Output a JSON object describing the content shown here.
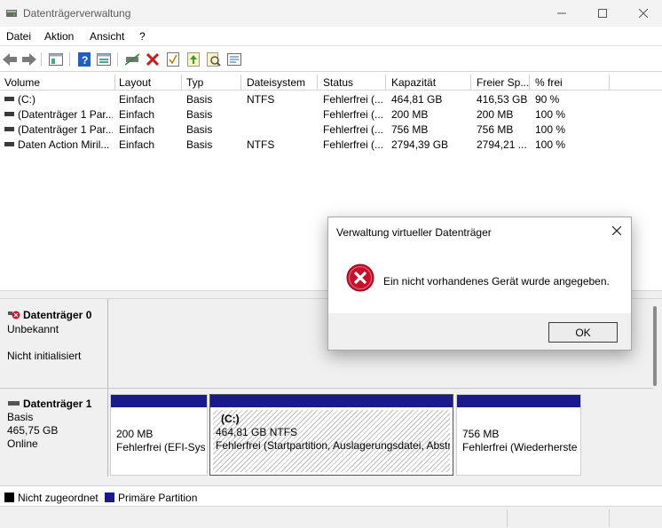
{
  "window": {
    "title": "Datenträgerverwaltung"
  },
  "menu": [
    "Datei",
    "Aktion",
    "Ansicht",
    "?"
  ],
  "toolbar": {
    "icons": [
      "back-icon",
      "forward-icon",
      "properties-icon",
      "help-icon",
      "view-icon",
      "connect-icon",
      "delete-icon",
      "check-icon",
      "import-icon",
      "search-icon",
      "refresh-icon"
    ]
  },
  "table": {
    "headers": [
      "Volume",
      "Layout",
      "Typ",
      "Dateisystem",
      "Status",
      "Kapazität",
      "Freier Sp...",
      "% frei"
    ],
    "rows": [
      [
        "(C:)",
        "Einfach",
        "Basis",
        "NTFS",
        "Fehlerfrei (...",
        "464,81 GB",
        "416,53 GB",
        "90 %"
      ],
      [
        "(Datenträger 1 Par...",
        "Einfach",
        "Basis",
        "",
        "Fehlerfrei (...",
        "200 MB",
        "200 MB",
        "100 %"
      ],
      [
        "(Datenträger 1 Par...",
        "Einfach",
        "Basis",
        "",
        "Fehlerfrei (...",
        "756 MB",
        "756 MB",
        "100 %"
      ],
      [
        "Daten Action Miril...",
        "Einfach",
        "Basis",
        "NTFS",
        "Fehlerfrei (...",
        "2794,39 GB",
        "2794,21 ...",
        "100 %"
      ]
    ]
  },
  "disks": {
    "disk0": {
      "name": "Datenträger 0",
      "type": "Unbekannt",
      "state": "Nicht initialisiert"
    },
    "disk1": {
      "name": "Datenträger 1",
      "type": "Basis",
      "size": "465,75 GB",
      "state": "Online",
      "partitions": [
        {
          "label": "",
          "size": "200 MB",
          "status": "Fehlerfrei (EFI-Syst"
        },
        {
          "label": "(C:)",
          "size": "464,81 GB NTFS",
          "status": "Fehlerfrei (Startpartition, Auslagerungsdatei, Abstr"
        },
        {
          "label": "",
          "size": "756 MB",
          "status": "Fehlerfrei (Wiederherste"
        }
      ]
    }
  },
  "legend": {
    "unallocated": "Nicht zugeordnet",
    "primary": "Primäre Partition",
    "colors": {
      "unallocated": "#000000",
      "primary": "#1a1a8c"
    }
  },
  "dialog": {
    "title": "Verwaltung virtueller Datenträger",
    "message": "Ein nicht vorhandenes Gerät wurde angegeben.",
    "ok_label": "OK",
    "icon": "error-icon"
  }
}
